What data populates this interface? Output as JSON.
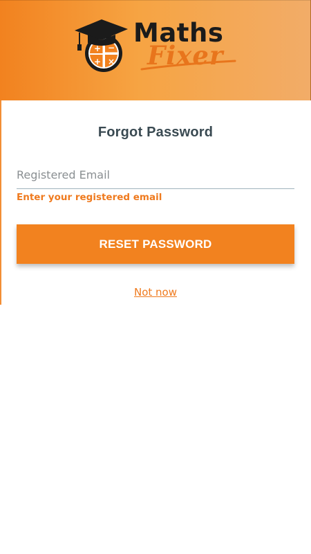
{
  "app": {
    "logo": {
      "word1": "Maths",
      "word2": "Fixer",
      "icon": "graduation-cap-calculator-icon"
    },
    "colors": {
      "accent": "#f2821f",
      "header_gradient_start": "#f2821f",
      "header_gradient_end": "#f2ac68",
      "title": "#3a4a52"
    }
  },
  "form": {
    "title": "Forgot Password",
    "email": {
      "placeholder": "Registered Email",
      "value": ""
    },
    "helper_text": "Enter your registered email",
    "reset_label": "RESET PASSWORD",
    "not_now_label": "Not now"
  }
}
